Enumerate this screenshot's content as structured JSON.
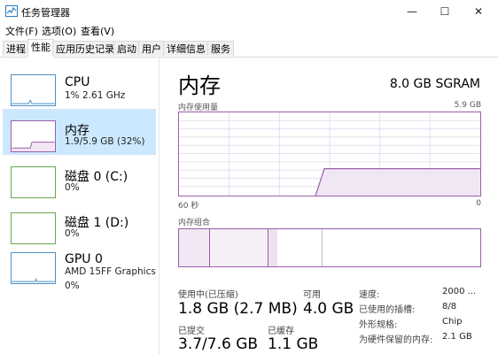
{
  "window": {
    "title": "任务管理器",
    "minimize": "—",
    "maximize": "☐",
    "close": "✕"
  },
  "menu": [
    "文件(F)",
    "选项(O)",
    "查看(V)"
  ],
  "tabs": [
    "进程",
    "性能",
    "应用历史记录",
    "启动",
    "用户",
    "详细信息",
    "服务"
  ],
  "active_tab": 1,
  "sidebar": [
    {
      "title": "CPU",
      "sub": "1% 2.61 GHz",
      "color": "#4a90c8"
    },
    {
      "title": "内存",
      "sub": "1.9/5.9 GB (32%)",
      "color": "#9a5fa9"
    },
    {
      "title": "磁盘 0 (C:)",
      "sub": "0%",
      "color": "#6aa84f"
    },
    {
      "title": "磁盘 1 (D:)",
      "sub": "0%",
      "color": "#6aa84f"
    },
    {
      "title": "GPU 0",
      "sub": "AMD 15FF Graphics",
      "sub2": "0%",
      "color": "#4a90c8"
    }
  ],
  "main": {
    "title": "内存",
    "spec": "8.0 GB SGRAM",
    "chart_label": "内存使用量",
    "chart_max": "5.9 GB",
    "time_left": "60 秒",
    "time_right": "0",
    "composition_label": "内存组合",
    "usage_level": 0.32
  },
  "stats": {
    "in_use_label": "使用中(已压缩)",
    "in_use_value": "1.8 GB (2.7 MB)",
    "available_label": "可用",
    "available_value": "4.0 GB",
    "committed_label": "已提交",
    "committed_value": "3.7/7.6 GB",
    "cached_label": "已缓存",
    "cached_value": "1.1 GB"
  },
  "details": [
    {
      "label": "速度:",
      "value": "2000 ..."
    },
    {
      "label": "已使用的插槽:",
      "value": "8/8"
    },
    {
      "label": "外形规格:",
      "value": "Chip"
    },
    {
      "label": "为硬件保留的内存:",
      "value": "2.1 GB"
    }
  ]
}
